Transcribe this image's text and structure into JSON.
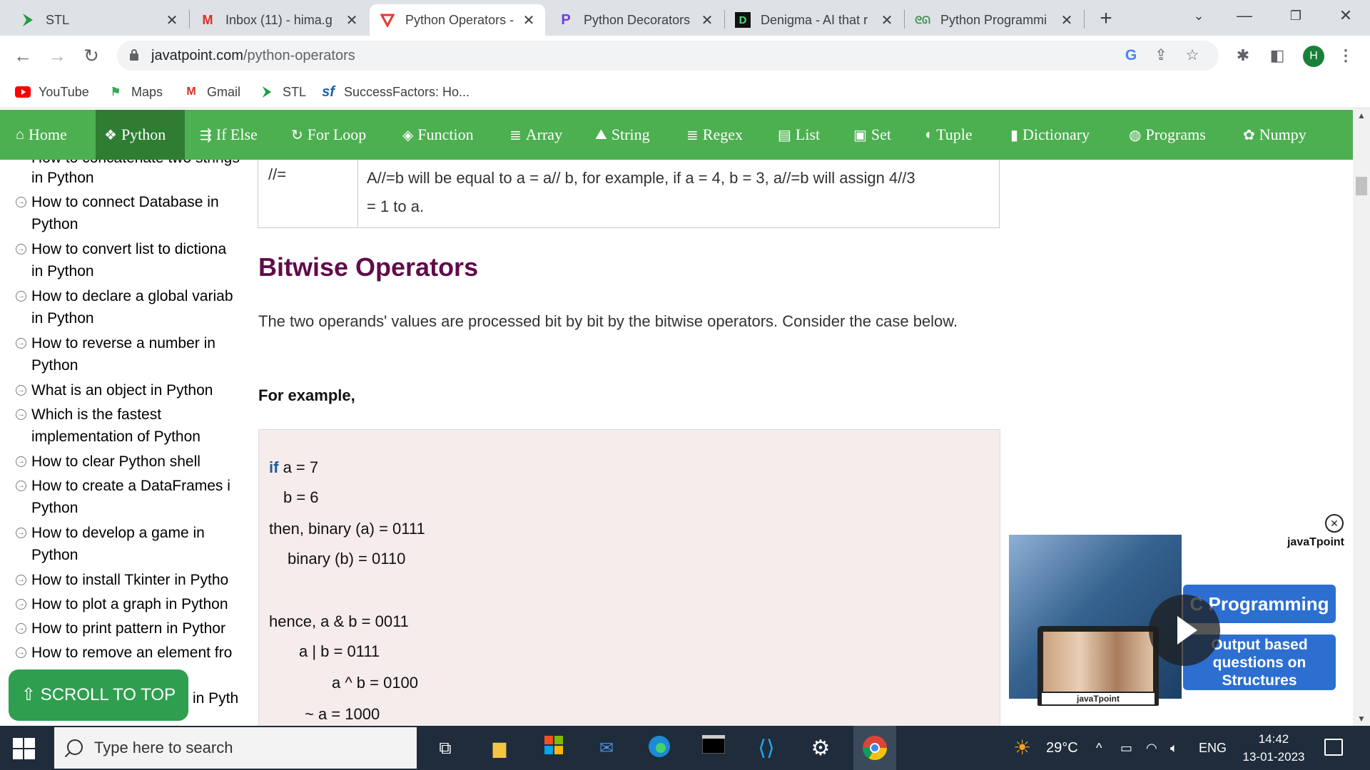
{
  "browser": {
    "tabs": [
      {
        "title": "STL",
        "favicon": "stl-chevron-icon",
        "active": false
      },
      {
        "title": "Inbox (11) - hima.g",
        "favicon": "gmail-icon",
        "active": false
      },
      {
        "title": "Python Operators -",
        "favicon": "javatpoint-icon",
        "active": true
      },
      {
        "title": "Python Decorators",
        "favicon": "p-icon",
        "active": false
      },
      {
        "title": "Denigma - AI that r",
        "favicon": "denigma-icon",
        "active": false
      },
      {
        "title": "Python Programmi",
        "favicon": "geeks-icon",
        "active": false
      }
    ],
    "url_domain": "javatpoint.com",
    "url_path": "/python-operators",
    "profile_initial": "H",
    "bookmarks": [
      {
        "label": "YouTube",
        "icon": "youtube-icon"
      },
      {
        "label": "Maps",
        "icon": "maps-icon"
      },
      {
        "label": "Gmail",
        "icon": "gmail-icon"
      },
      {
        "label": "STL",
        "icon": "stl-chevron-icon"
      },
      {
        "label": "SuccessFactors: Ho...",
        "icon": "sf-icon"
      }
    ]
  },
  "nav": {
    "items": [
      {
        "label": "Home",
        "icon": "home-icon"
      },
      {
        "label": "Python",
        "icon": "python-icon"
      },
      {
        "label": "If Else",
        "icon": "ifelse-icon"
      },
      {
        "label": "For Loop",
        "icon": "loop-icon"
      },
      {
        "label": "Function",
        "icon": "function-icon"
      },
      {
        "label": "Array",
        "icon": "array-icon"
      },
      {
        "label": "String",
        "icon": "string-icon"
      },
      {
        "label": "Regex",
        "icon": "regex-icon"
      },
      {
        "label": "List",
        "icon": "list-icon"
      },
      {
        "label": "Set",
        "icon": "set-icon"
      },
      {
        "label": "Tuple",
        "icon": "tuple-icon"
      },
      {
        "label": "Dictionary",
        "icon": "dictionary-icon"
      },
      {
        "label": "Programs",
        "icon": "programs-icon"
      },
      {
        "label": "Numpy",
        "icon": "numpy-icon"
      }
    ],
    "active": "Python"
  },
  "sidebar": {
    "top_partial": "How to concatenate two strings",
    "top_partial_line2": "in Python",
    "items": [
      {
        "line1": "How to connect Database in",
        "line2": "Python"
      },
      {
        "line1": "How to convert list to dictiona",
        "line2": "in Python"
      },
      {
        "line1": "How to declare a global variab",
        "line2": "in Python"
      },
      {
        "line1": "How to reverse a number in",
        "line2": "Python"
      },
      {
        "line1": "What is an object in Python",
        "line2": ""
      },
      {
        "line1": "Which is the fastest",
        "line2": "implementation of Python"
      },
      {
        "line1": "How to clear Python shell",
        "line2": ""
      },
      {
        "line1": "How to create a DataFrames i",
        "line2": "Python"
      },
      {
        "line1": "How to develop a game in",
        "line2": "Python"
      },
      {
        "line1": "How to install Tkinter in Pytho",
        "line2": ""
      },
      {
        "line1": "How to plot a graph in Python",
        "line2": ""
      },
      {
        "line1": "How to print pattern in Pythor",
        "line2": ""
      },
      {
        "line1": "How to remove an element fro",
        "line2": ""
      }
    ],
    "bottom_partial": "in Pyth",
    "scroll_to_top": "⇧ SCROLL TO TOP"
  },
  "content": {
    "table_row": {
      "operator": "//=",
      "desc_line1": "A//=b will be equal to a = a// b, for example, if a = 4, b = 3, a//=b will assign 4//3",
      "desc_line2": "= 1 to a."
    },
    "heading": "Bitwise Operators",
    "paragraph": "The two operands' values are processed bit by bit by the bitwise operators. Consider the case below.",
    "for_example": "For example,",
    "code": {
      "kw_if": "if",
      "l1": " a = 7",
      "l2": "b = 6",
      "l3": "then, binary (a) = 0111",
      "l4": "binary (b) = 0110",
      "l5": "hence, a & b = 0011",
      "l6": "a | b = 0111",
      "l7": "a ^ b = 0100",
      "l8": "~ a = 1000"
    }
  },
  "ad": {
    "logo": "javaTpoint",
    "button1": "C Programming",
    "button2_l1": "Output based",
    "button2_l2": "questions on",
    "button2_l3": "Structures",
    "laptop_logo": "javaTpoint"
  },
  "taskbar": {
    "search_placeholder": "Type here to search",
    "temperature": "29°C",
    "language": "ENG",
    "time": "14:42",
    "date": "13-01-2023"
  }
}
